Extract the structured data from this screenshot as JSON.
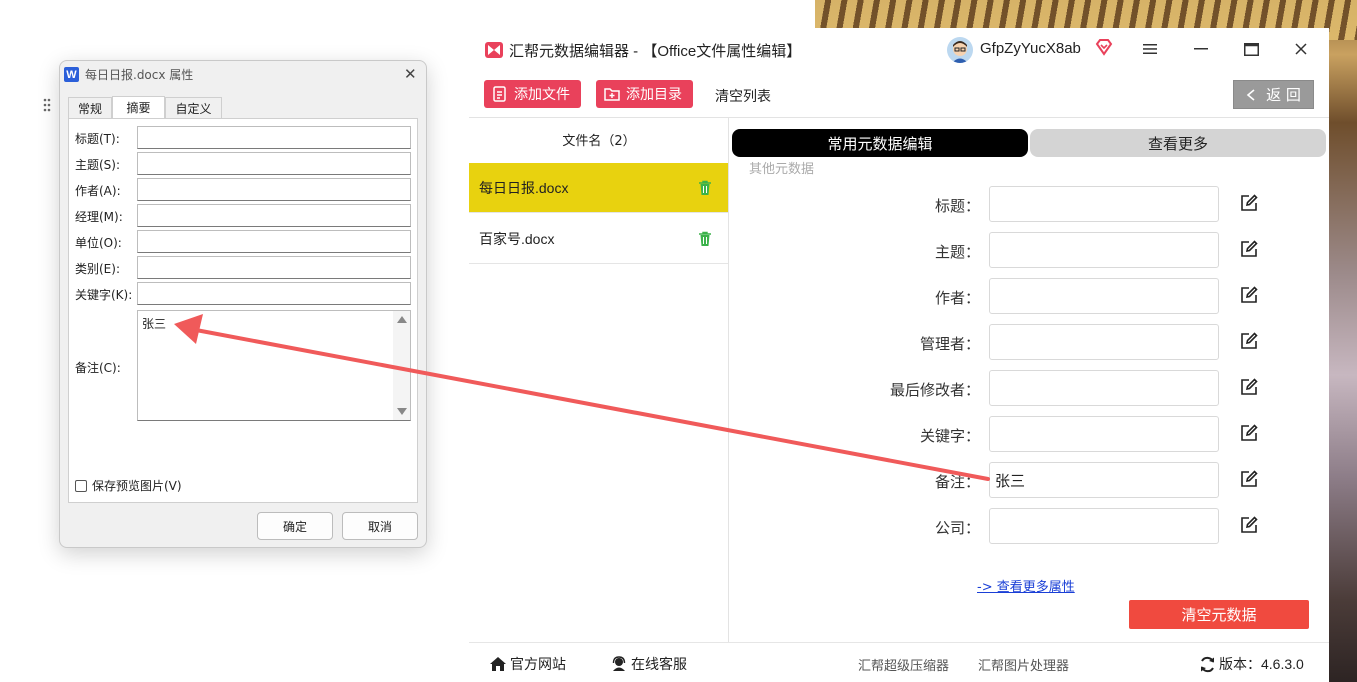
{
  "app": {
    "title": "汇帮元数据编辑器 - 【Office文件属性编辑】",
    "username": "GfpZyYucX8ab",
    "colors": {
      "accent": "#e9415b",
      "active_file": "#e8d20f",
      "danger": "#f04a3f"
    }
  },
  "toolbar": {
    "add_file": "添加文件",
    "add_folder": "添加目录",
    "clear_list": "清空列表",
    "back": "返 回"
  },
  "files": {
    "header": "文件名（2）",
    "items": [
      {
        "name": "每日日报.docx",
        "active": true
      },
      {
        "name": "百家号.docx",
        "active": false
      }
    ]
  },
  "meta": {
    "tab_common": "常用元数据编辑",
    "tab_more": "查看更多",
    "other_label": "其他元数据",
    "fields": [
      {
        "label": "标题：",
        "value": ""
      },
      {
        "label": "主题：",
        "value": ""
      },
      {
        "label": "作者：",
        "value": ""
      },
      {
        "label": "管理者：",
        "value": ""
      },
      {
        "label": "最后修改者：",
        "value": ""
      },
      {
        "label": "关键字：",
        "value": ""
      },
      {
        "label": "备注：",
        "value": "张三"
      },
      {
        "label": "公司：",
        "value": ""
      }
    ],
    "more_link": "-> 查看更多属性",
    "clear_button": "清空元数据"
  },
  "footer": {
    "website": "官方网站",
    "support": "在线客服",
    "compressor": "汇帮超级压缩器",
    "image_tool": "汇帮图片处理器",
    "version": "版本：4.6.3.0"
  },
  "dialog": {
    "icon_letter": "W",
    "title": "每日日报.docx 属性",
    "tabs": [
      "常规",
      "摘要",
      "自定义"
    ],
    "fields": [
      {
        "label": "标题(T):"
      },
      {
        "label": "主题(S):"
      },
      {
        "label": "作者(A):"
      },
      {
        "label": "经理(M):"
      },
      {
        "label": "单位(O):"
      },
      {
        "label": "类别(E):"
      },
      {
        "label": "关键字(K):"
      }
    ],
    "note_label": "备注(C):",
    "note_value": "张三",
    "save_preview": "保存预览图片(V)",
    "ok": "确定",
    "cancel": "取消"
  }
}
